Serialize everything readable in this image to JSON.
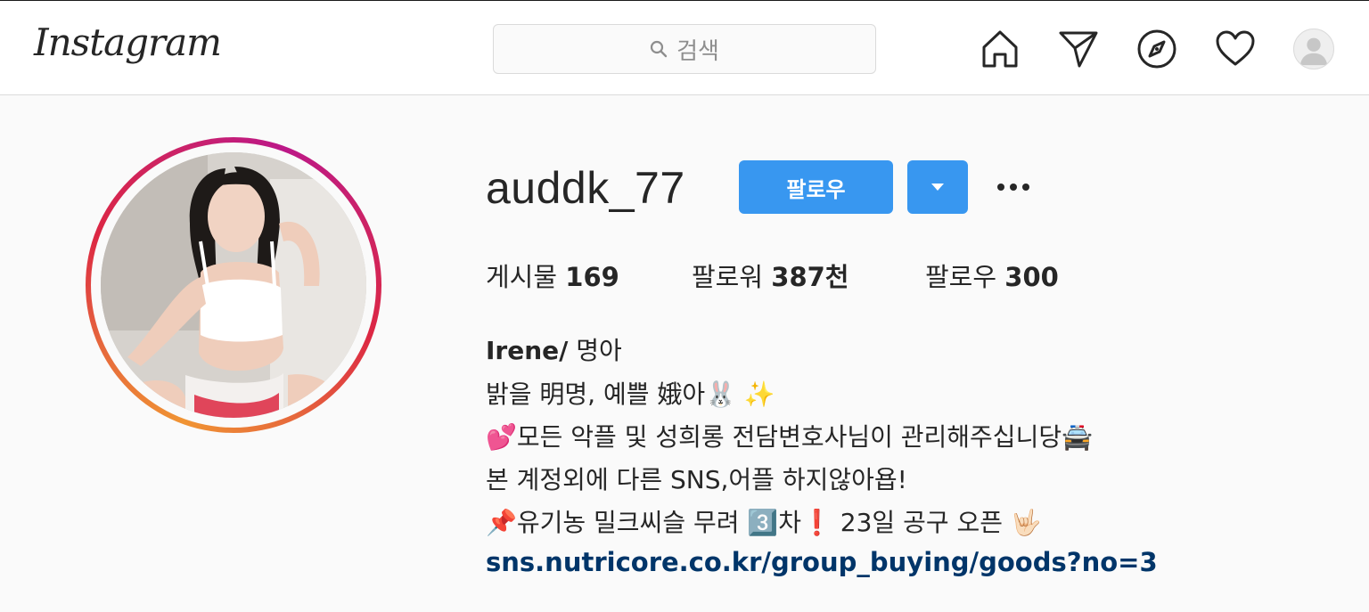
{
  "header": {
    "logo": "Instagram",
    "search_placeholder": "검색",
    "nav_icons": [
      "home-icon",
      "direct-icon",
      "explore-icon",
      "activity-heart-icon",
      "profile-avatar"
    ]
  },
  "profile": {
    "username": "auddk_77",
    "follow_label": "팔로우",
    "stats": {
      "posts_label": "게시물",
      "posts_value": "169",
      "followers_label": "팔로워",
      "followers_value": "387천",
      "following_label": "팔로우",
      "following_value": "300"
    },
    "bio": {
      "name": "Irene/",
      "name_suffix": " 명아",
      "line1": "밝을 明명, 예쁠 娥아🐰 ✨",
      "line2": "💕모든 악플 및 성희롱 전담변호사님이 관리해주십니당🚔",
      "line3": "본 계정외에 다른 SNS,어플 하지않아욥!",
      "line4": "📌유기농 밀크씨슬 무려 3️⃣차❗️ 23일 공구 오픈 🤟🏻",
      "link": "sns.nutricore.co.kr/group_buying/goods?no=3"
    }
  },
  "colors": {
    "follow_button": "#3897f0",
    "link": "#003569",
    "background": "#fafafa"
  }
}
